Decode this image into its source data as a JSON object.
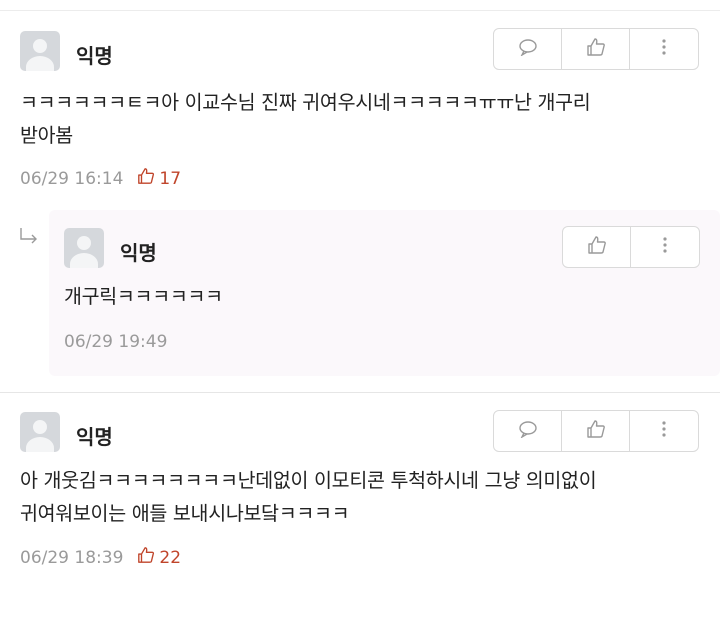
{
  "comments": [
    {
      "author": "익명",
      "text": "ㅋㅋㅋㅋㅋㅋㅌㅋ아 이교수님 진짜 귀여우시네ㅋㅋㅋㅋㅋㅠㅠ난 개구리\n받아봄",
      "time": "06/29 16:14",
      "likes": "17"
    },
    {
      "author": "익명",
      "text": "개구릭ㅋㅋㅋㅋㅋㅋ",
      "time": "06/29 19:49",
      "is_reply": true
    },
    {
      "author": "익명",
      "text": "아 개웃김ㅋㅋㅋㅋㅋㅋㅋㅋ난데없이 이모티콘 투척하시네 그냥 의미없이\n귀여워보이는 애들 보내시나보닼ㅋㅋㅋㅋ",
      "time": "06/29 18:39",
      "likes": "22"
    }
  ],
  "icons": {
    "reply": "speech-bubble-icon",
    "like": "thumbs-up-icon",
    "more": "vertical-dots-icon",
    "reply_indicator": "reply-arrow-icon"
  },
  "colors": {
    "like_accent": "#c0452b",
    "reply_background": "#fbf8fb",
    "meta_text": "#9a9a9a"
  }
}
